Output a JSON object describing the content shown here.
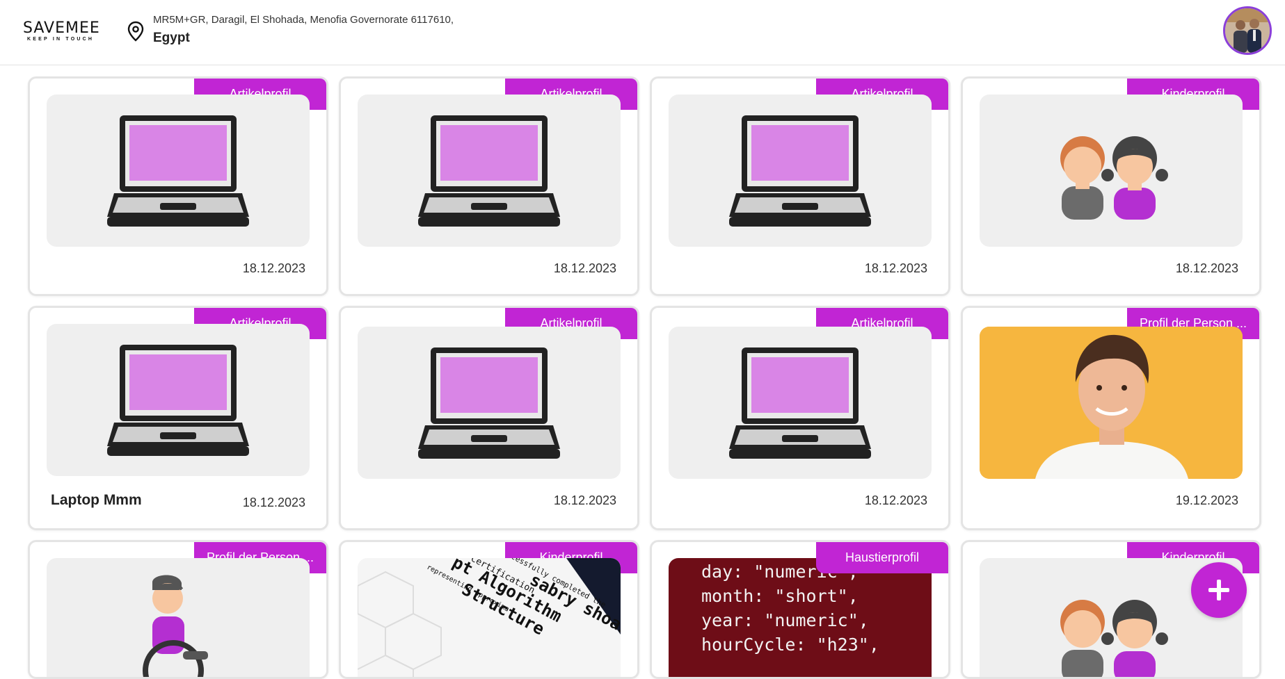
{
  "header": {
    "brand": "SAVEMEE",
    "tagline": "KEEP IN TOUCH",
    "address_line1": "MR5M+GR, Daragil, El Shohada, Menofia Governorate 6117610,",
    "address_line2": "Egypt"
  },
  "cards": [
    {
      "badge": "Artikelprofil",
      "date": "18.12.2023",
      "title": "",
      "image": "laptop-icon"
    },
    {
      "badge": "Artikelprofil",
      "date": "18.12.2023",
      "title": "",
      "image": "laptop-icon"
    },
    {
      "badge": "Artikelprofil",
      "date": "18.12.2023",
      "title": "",
      "image": "laptop-icon"
    },
    {
      "badge": "Kinderprofil",
      "date": "18.12.2023",
      "title": "",
      "image": "children-icon"
    },
    {
      "badge": "Artikelprofil",
      "date": "18.12.2023",
      "title": "Laptop Mmm",
      "image": "laptop-icon"
    },
    {
      "badge": "Artikelprofil",
      "date": "18.12.2023",
      "title": "",
      "image": "laptop-icon"
    },
    {
      "badge": "Artikelprofil",
      "date": "18.12.2023",
      "title": "",
      "image": "laptop-icon"
    },
    {
      "badge": "Profil der Person ...",
      "date": "19.12.2023",
      "title": "",
      "image": "boy-photo"
    },
    {
      "badge": "Profil der Person ...",
      "date": "",
      "title": "",
      "image": "wheelchair-person-icon"
    },
    {
      "badge": "Kinderprofil",
      "date": "",
      "title": "",
      "image": "certificate-photo"
    },
    {
      "badge": "Haustierprofil",
      "date": "",
      "title": "",
      "image": "code-screenshot"
    },
    {
      "badge": "Kinderprofil",
      "date": "",
      "title": "",
      "image": "children-icon"
    }
  ],
  "code_snippet": {
    "lines": [
      "day: \"numeric\",",
      "month: \"short\",",
      "year: \"numeric\",",
      "hourCycle: \"h23\","
    ]
  },
  "fab": {
    "icon": "plus-icon"
  },
  "colors": {
    "accent": "#c125d4",
    "avatar_ring": "#8b3fd9"
  }
}
